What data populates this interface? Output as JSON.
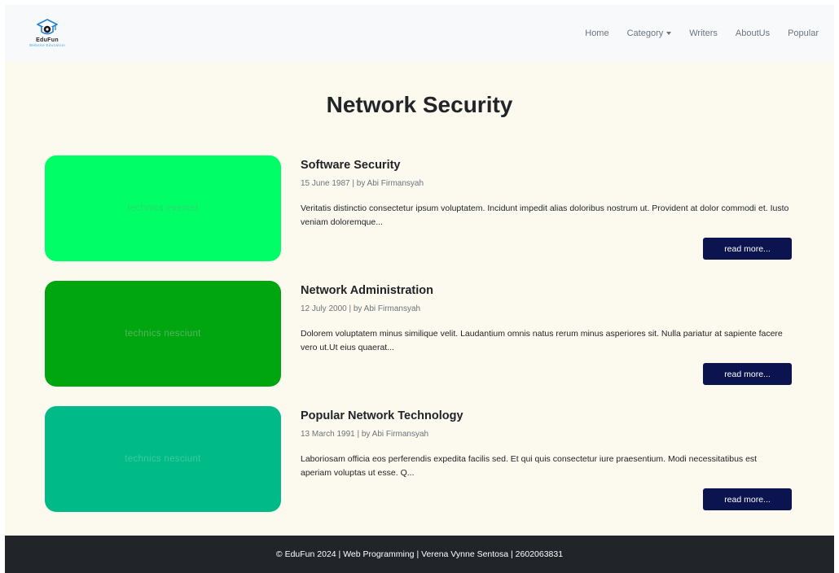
{
  "brand": {
    "name": "EduFun",
    "tagline": "Website Education",
    "logo_icon": "graduation-cap-icon"
  },
  "nav": {
    "items": [
      {
        "label": "Home"
      },
      {
        "label": "Category",
        "dropdown": true
      },
      {
        "label": "Writers"
      },
      {
        "label": "AboutUs"
      },
      {
        "label": "Popular"
      }
    ]
  },
  "page": {
    "title": "Network Security"
  },
  "articles": [
    {
      "title": "Software Security",
      "meta": "15 June 1987 | by Abi Firmansyah",
      "excerpt": "Veritatis distinctio consectetur ipsum voluptatem. Incidunt impedit alias doloribus nostrum ut. Provident at dolor commodi et. Iusto veniam doloremque...",
      "image_text": "technics eveniet",
      "image_color": "#00ff66",
      "image_text_color": "#2cd76e",
      "read_more": "read more..."
    },
    {
      "title": "Network Administration",
      "meta": "12 July 2000 | by Abi Firmansyah",
      "excerpt": "Dolorem voluptatem minus similique velit. Laudantium omnis natus rerum minus asperiores sit. Nulla pariatur at sapiente facere vero ut.Ut eius quaerat...",
      "image_text": "technics nesciunt",
      "image_color": "#00a610",
      "image_text_color": "#58b55e",
      "read_more": "read more..."
    },
    {
      "title": "Popular Network Technology",
      "meta": "13 March 1991 | by Abi Firmansyah",
      "excerpt": "Laboriosam officia eos perferendis expedita facilis sed. Et qui quis consectetur iure praesentium. Modi necessitatibus est aperiam voluptas ut esse. Q...",
      "image_text": "technics nesciunt",
      "image_color": "#00bb88",
      "image_text_color": "#3ec99c",
      "read_more": "read more..."
    }
  ],
  "footer": {
    "text": "© EduFun 2024 | Web Programming | Verena Vynne Sentosa | 2602063831"
  },
  "colors": {
    "navbar_bg": "#f8f9fa",
    "main_bg": "#fcf9ee",
    "footer_bg": "#212529",
    "button_bg": "#0c1450"
  }
}
